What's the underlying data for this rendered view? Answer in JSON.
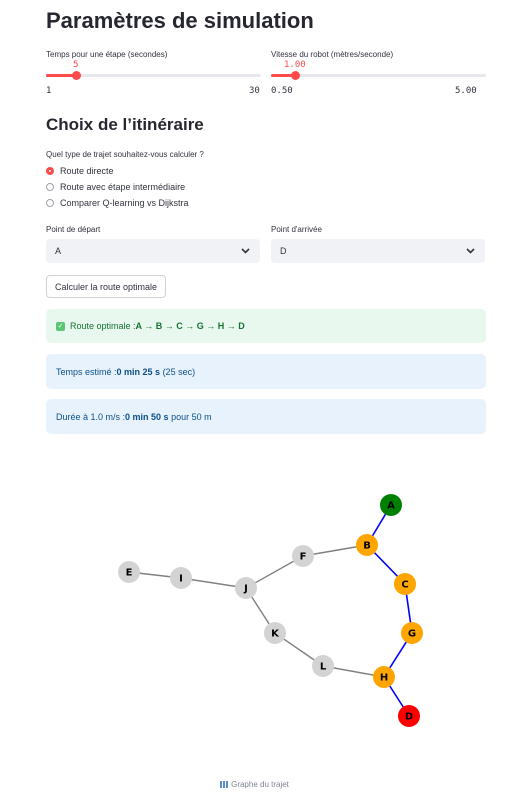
{
  "simulation": {
    "title": "Paramètres de simulation",
    "step_slider": {
      "label": "Temps pour une étape (secondes)",
      "value": "5",
      "min": "1",
      "max": "30",
      "fraction": 0.138
    },
    "speed_slider": {
      "label": "Vitesse du robot (mètres/seconde)",
      "value": "1.00",
      "min": "0.50",
      "max": "5.00",
      "fraction": 0.111
    }
  },
  "itinerary": {
    "title": "Choix de l’itinéraire",
    "question": "Quel type de trajet souhaitez-vous calculer ?",
    "options": [
      "Route directe",
      "Route avec étape intermédiaire",
      "Comparer Q-learning vs Dijkstra"
    ],
    "selected_index": 0,
    "start": {
      "label": "Point de départ",
      "value": "A"
    },
    "end": {
      "label": "Point d'arrivée",
      "value": "D"
    },
    "compute_button": "Calculer la route optimale"
  },
  "results": {
    "route_prefix": "Route optimale : ",
    "route_value": "A → B → C → G → H → D",
    "time_prefix": "Temps estimé : ",
    "time_value": "0 min 25 s",
    "time_suffix": " (25 sec)",
    "duration_prefix": "Durée à 1.0 m/s : ",
    "duration_value": "0 min 50 s",
    "duration_suffix": " pour 50 m"
  },
  "graph": {
    "caption": "Graphe du trajet",
    "caption_icon": "chart-icon",
    "colors": {
      "start": "#008000",
      "end": "#ff0000",
      "path": "#ffa500",
      "other": "#d3d3d3",
      "path_edge": "#0000ff",
      "edge": "#808080"
    },
    "nodes": [
      {
        "id": "A",
        "role": "start"
      },
      {
        "id": "B",
        "role": "path"
      },
      {
        "id": "C",
        "role": "path"
      },
      {
        "id": "G",
        "role": "path"
      },
      {
        "id": "H",
        "role": "path"
      },
      {
        "id": "D",
        "role": "end"
      },
      {
        "id": "E",
        "role": "other"
      },
      {
        "id": "I",
        "role": "other"
      },
      {
        "id": "J",
        "role": "other"
      },
      {
        "id": "F",
        "role": "other"
      },
      {
        "id": "K",
        "role": "other"
      },
      {
        "id": "L",
        "role": "other"
      }
    ],
    "edges": [
      {
        "from": "A",
        "to": "B",
        "on_path": true
      },
      {
        "from": "B",
        "to": "C",
        "on_path": true
      },
      {
        "from": "C",
        "to": "G",
        "on_path": true
      },
      {
        "from": "G",
        "to": "H",
        "on_path": true
      },
      {
        "from": "H",
        "to": "D",
        "on_path": true
      },
      {
        "from": "E",
        "to": "I",
        "on_path": false
      },
      {
        "from": "I",
        "to": "J",
        "on_path": false
      },
      {
        "from": "J",
        "to": "F",
        "on_path": false
      },
      {
        "from": "F",
        "to": "B",
        "on_path": false
      },
      {
        "from": "J",
        "to": "K",
        "on_path": false
      },
      {
        "from": "K",
        "to": "L",
        "on_path": false
      },
      {
        "from": "L",
        "to": "H",
        "on_path": false
      }
    ]
  }
}
